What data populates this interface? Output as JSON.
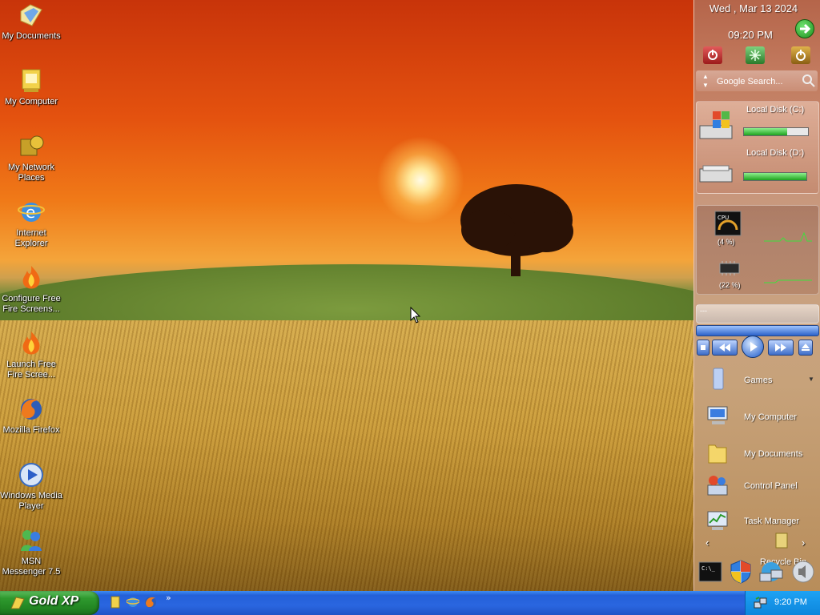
{
  "desktop": {
    "icons": [
      {
        "label": "My Documents",
        "icon": "my-documents-icon"
      },
      {
        "label": "My Computer",
        "icon": "my-computer-icon"
      },
      {
        "label": "My Network Places",
        "icon": "network-places-icon"
      },
      {
        "label": "Internet Explorer",
        "icon": "internet-explorer-icon"
      },
      {
        "label": "Configure Free Fire Screens...",
        "icon": "fire-icon"
      },
      {
        "label": "Launch Free Fire Scree...",
        "icon": "fire-icon"
      },
      {
        "label": "Mozilla Firefox",
        "icon": "firefox-icon"
      },
      {
        "label": "Windows Media Player",
        "icon": "media-player-icon"
      },
      {
        "label": "MSN Messenger 7.5",
        "icon": "msn-messenger-icon"
      }
    ]
  },
  "sidebar": {
    "date": "Wed , Mar 13 2024",
    "time": "09:20 PM",
    "search_placeholder": "Google Search...",
    "disks": [
      {
        "label": "Local Disk (C:)",
        "used_fraction": 0.68
      },
      {
        "label": "Local Disk (D:)",
        "used_fraction": 1.0
      }
    ],
    "cpu": {
      "label": "(4 %)",
      "percent": 4
    },
    "memory": {
      "label": "(22 %)",
      "percent": 22
    },
    "player_track": "---",
    "launcher": [
      {
        "label": "Games",
        "icon": "games-icon"
      },
      {
        "label": "My Computer",
        "icon": "my-computer-icon"
      },
      {
        "label": "My Documents",
        "icon": "my-documents-icon"
      },
      {
        "label": "Control Panel",
        "icon": "control-panel-icon"
      },
      {
        "label": "Task Manager",
        "icon": "task-manager-icon"
      },
      {
        "label": "Recycle Bin",
        "icon": "recycle-bin-icon"
      }
    ]
  },
  "taskbar": {
    "start_label": "Gold XP",
    "quick_launch": [
      "show-desktop-icon",
      "internet-explorer-icon",
      "firefox-icon"
    ],
    "more": "»",
    "clock": "9:20 PM"
  },
  "colors": {
    "taskbar": "#2a66e0",
    "start_button": "#2f9a2f",
    "tray": "#0d86dc"
  }
}
